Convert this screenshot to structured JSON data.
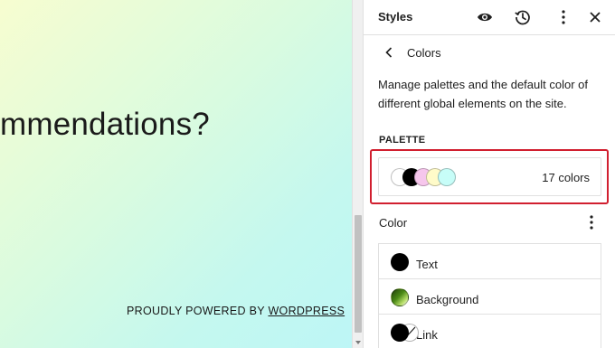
{
  "canvas": {
    "headline": "mmendations?",
    "footer_prefix": "PROUDLY POWERED BY",
    "footer_link": "WORDPRESS"
  },
  "panel": {
    "title": "Styles",
    "header_icons": [
      "eye-icon",
      "revisions-icon",
      "more-vertical-icon",
      "close-icon"
    ],
    "nav": {
      "back_icon": "chevron-left-icon",
      "title": "Colors"
    },
    "description": "Manage palettes and the default color of different global elements on the site.",
    "palette": {
      "label": "PALETTE",
      "count_label": "17 colors",
      "swatches": [
        "#ffffff",
        "#000000",
        "#f6c6ec",
        "#fffbc9",
        "#c7fdf8"
      ]
    },
    "color_section": {
      "heading": "Color",
      "more_icon": "more-vertical-icon",
      "elements": [
        {
          "label": "Text",
          "swatch": "#000000"
        },
        {
          "label": "Background",
          "swatch": "gradient-green"
        },
        {
          "label": "Link",
          "swatch": "#000000",
          "swatch2": "#ffffff"
        }
      ]
    }
  },
  "colors": {
    "accent_highlight": "#d11f2f",
    "canvas_gradient_start": "#f7fdd0",
    "canvas_gradient_end": "#bdf6f6"
  }
}
